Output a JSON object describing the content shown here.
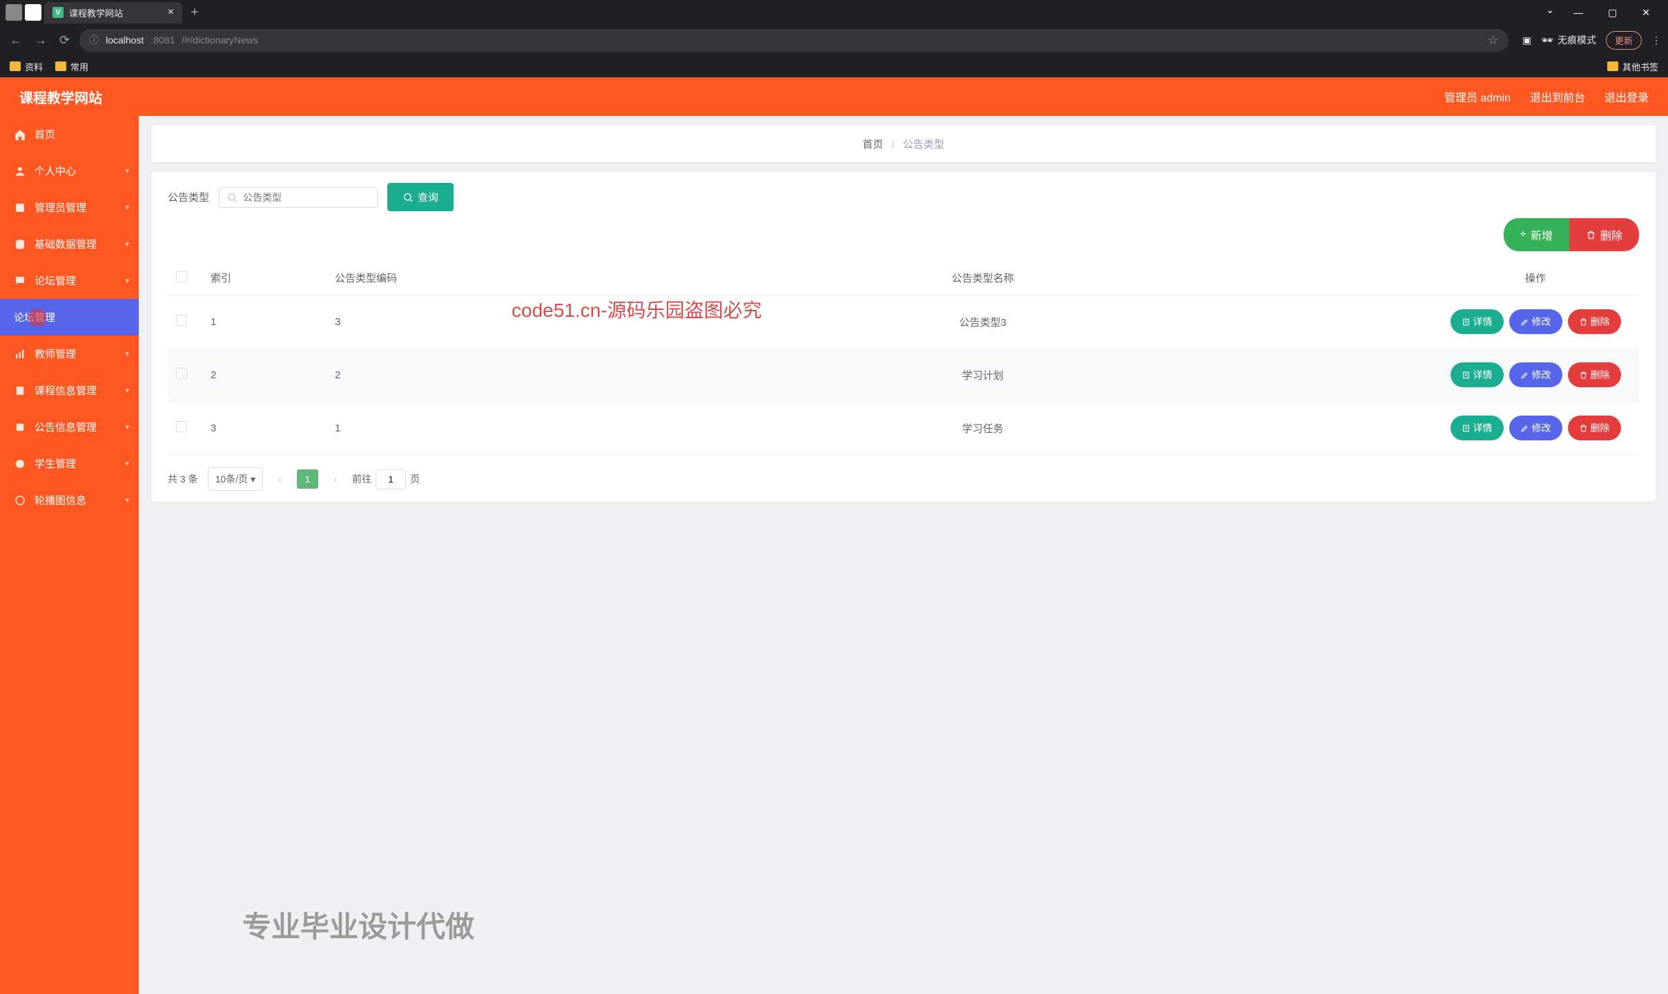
{
  "browser": {
    "tab_title": "课程教学网站",
    "url_prefix": "localhost",
    "url_port": ":8081",
    "url_path": "/#/dictionaryNews",
    "incognito_label": "无痕模式",
    "update_label": "更新",
    "bookmarks": {
      "b1": "资料",
      "b2": "常用",
      "other": "其他书签"
    }
  },
  "header": {
    "app_title": "课程教学网站",
    "user_label": "管理员 admin",
    "to_front": "退出到前台",
    "logout": "退出登录"
  },
  "sidebar": {
    "items": [
      {
        "label": "首页"
      },
      {
        "label": "个人中心"
      },
      {
        "label": "管理员管理"
      },
      {
        "label": "基础数据管理"
      },
      {
        "label": "论坛管理"
      },
      {
        "label": "论坛管理"
      },
      {
        "label": "教师管理"
      },
      {
        "label": "课程信息管理"
      },
      {
        "label": "公告信息管理"
      },
      {
        "label": "学生管理"
      },
      {
        "label": "轮播图信息"
      }
    ]
  },
  "breadcrumb": {
    "home": "首页",
    "current": "公告类型"
  },
  "search": {
    "label": "公告类型",
    "placeholder": "公告类型",
    "button": "查询"
  },
  "actions": {
    "add": "新增",
    "delete": "删除"
  },
  "table": {
    "headers": {
      "index": "索引",
      "code": "公告类型编码",
      "name": "公告类型名称",
      "ops": "操作"
    },
    "rows": [
      {
        "index": "1",
        "code": "3",
        "name": "公告类型3"
      },
      {
        "index": "2",
        "code": "2",
        "name": "学习计划"
      },
      {
        "index": "3",
        "code": "1",
        "name": "学习任务"
      }
    ],
    "row_buttons": {
      "detail": "详情",
      "edit": "修改",
      "delete": "删除"
    }
  },
  "pagination": {
    "total": "共 3 条",
    "page_size": "10条/页",
    "current_page": "1",
    "jump_prefix": "前往",
    "jump_value": "1",
    "jump_suffix": "页"
  },
  "watermark": "code51.cn-源码乐园盗图必究",
  "footer_promo": "专业毕业设计代做"
}
